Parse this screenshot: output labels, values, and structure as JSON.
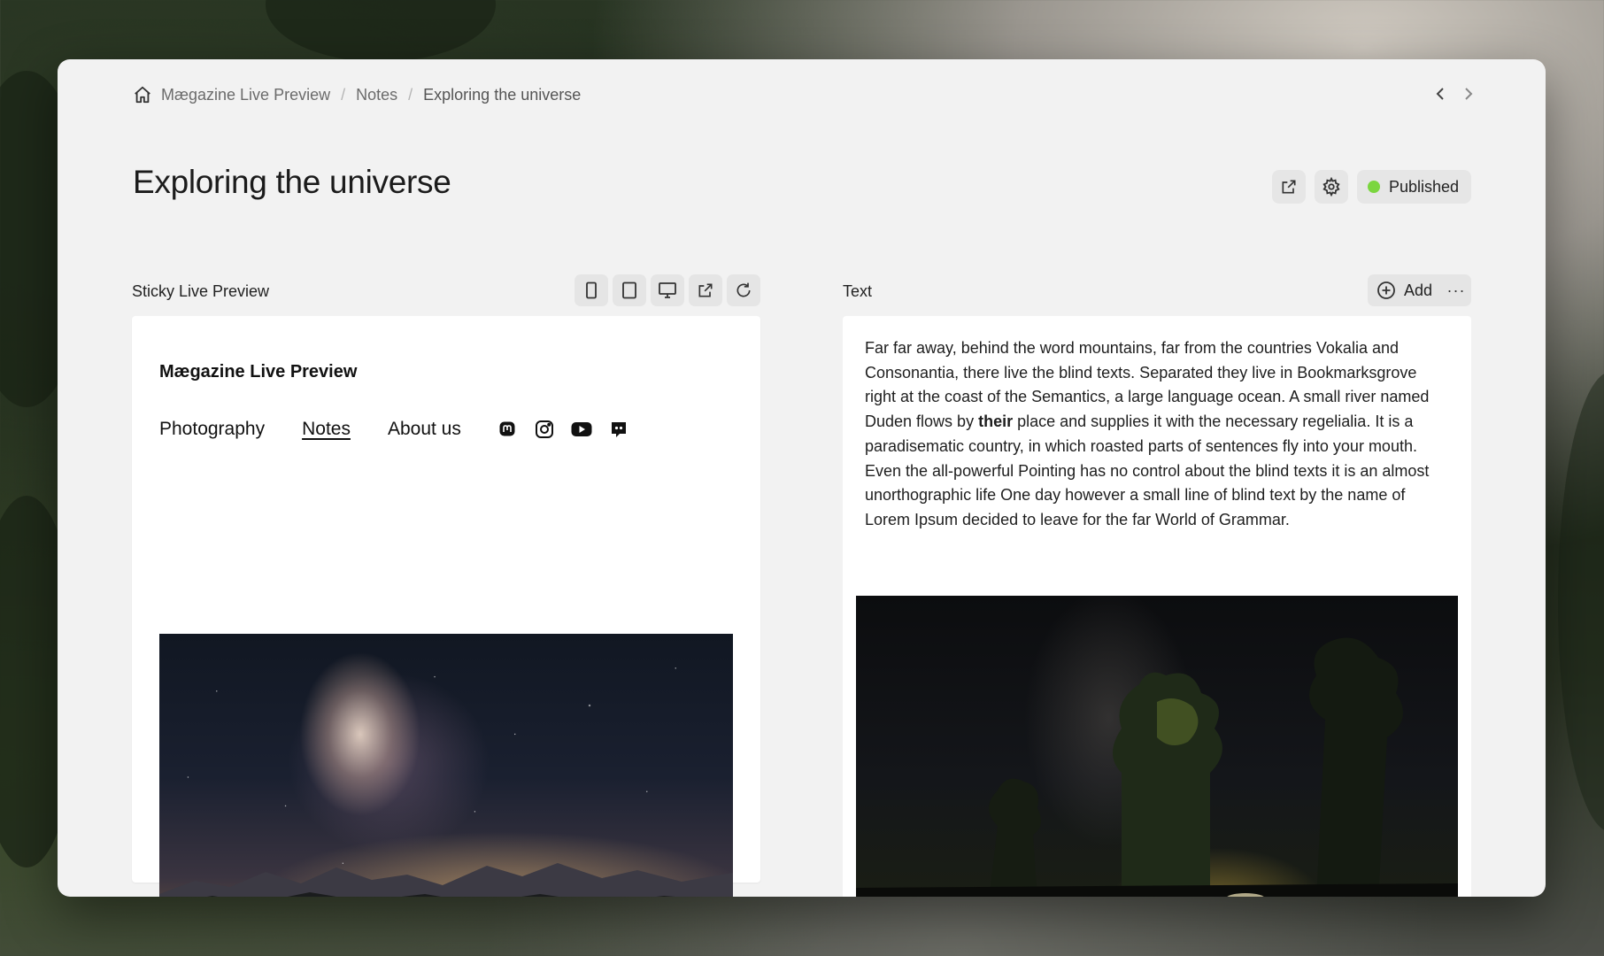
{
  "breadcrumb": {
    "items": [
      "Mægazine Live Preview",
      "Notes",
      "Exploring the universe"
    ],
    "separator": "/"
  },
  "page": {
    "title": "Exploring the universe",
    "status": "Published",
    "status_color": "#7bd63f"
  },
  "preview_panel": {
    "label": "Sticky Live Preview",
    "toolbar_icons": [
      "phone-icon",
      "tablet-icon",
      "desktop-icon",
      "external-link-icon",
      "refresh-icon"
    ],
    "site": {
      "title": "Mægazine Live Preview",
      "nav": [
        "Photography",
        "Notes",
        "About us"
      ],
      "active_nav": "Notes",
      "socials": [
        "mastodon-icon",
        "instagram-icon",
        "youtube-icon",
        "discord-icon"
      ]
    }
  },
  "text_panel": {
    "label": "Text",
    "add_label": "Add",
    "more_label": "···",
    "paragraph_before": "Far far away, behind the word mountains, far from the countries Vokalia and Consonantia, there live the blind texts. Separated they live in Bookmarksgrove right at the coast of the Semantics, a large language ocean. A small river named Duden flows by ",
    "paragraph_bold": "their",
    "paragraph_after": " place and supplies it with the necessary regelialia. It is a paradisematic country, in which roasted parts of sentences fly into your mouth. Even the all-powerful Pointing has no control about the blind texts it is an almost unorthographic life One day however a small line of blind text by the name of Lorem Ipsum decided to leave for the far World of Grammar."
  }
}
